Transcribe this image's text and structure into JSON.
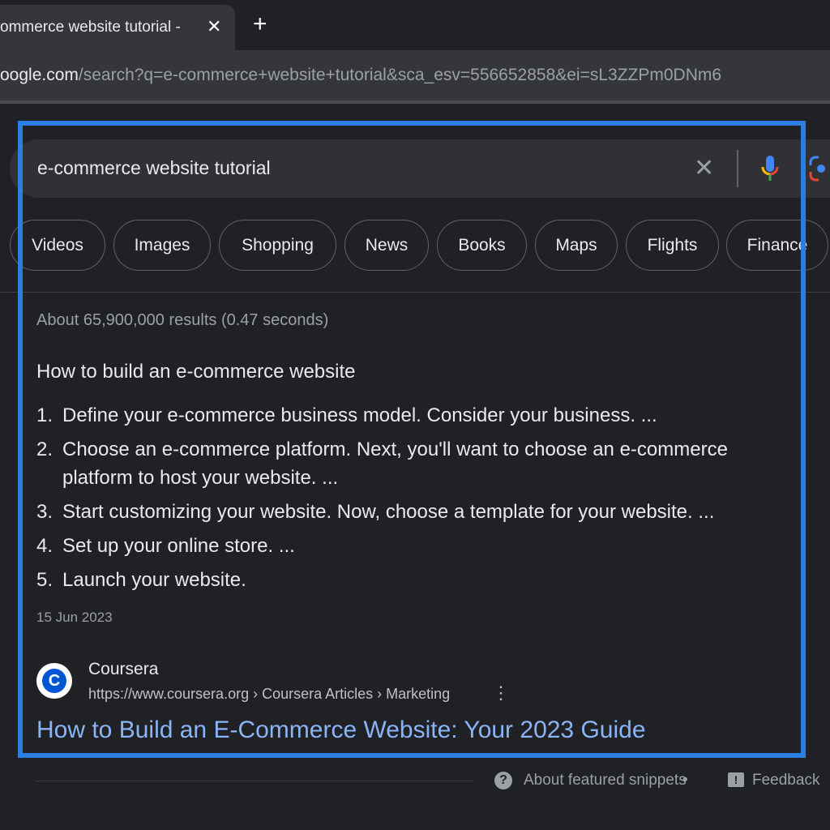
{
  "browser": {
    "tab_title": "e-commerce website tutorial - Google Search",
    "tab_title_visible": "ommerce website tutorial -",
    "url_host": "oogle.com",
    "url_path": "/search?q=e-commerce+website+tutorial&sca_esv=556652858&ei=sL3ZZPm0DNm6"
  },
  "search": {
    "query": "e-commerce website tutorial",
    "chips": [
      "Videos",
      "Images",
      "Shopping",
      "News",
      "Books",
      "Maps",
      "Flights",
      "Finance"
    ]
  },
  "results": {
    "stats": "About 65,900,000 results (0.47 seconds)",
    "snippet": {
      "heading": "How to build an e-commerce website",
      "items": [
        {
          "n": "1.",
          "text": "Define your e-commerce business model. Consider your business. ..."
        },
        {
          "n": "2.",
          "text": "Choose an e-commerce platform. Next, you'll want to choose an e-commerce platform to host your website. ..."
        },
        {
          "n": "3.",
          "text": "Start customizing your website. Now, choose a template for your website. ..."
        },
        {
          "n": "4.",
          "text": "Set up your online store. ..."
        },
        {
          "n": "5.",
          "text": "Launch your website."
        }
      ],
      "date": "15 Jun 2023",
      "site_name": "Coursera",
      "favicon_letter": "C",
      "cite": "https://www.coursera.org › Coursera Articles › Marketing",
      "title": "How to Build an E-Commerce Website: Your 2023 Guide"
    },
    "footer": {
      "about": "About featured snippets",
      "separator": "•",
      "feedback": "Feedback"
    }
  },
  "colors": {
    "background": "#202124",
    "link": "#8ab4f8",
    "highlight": "#2a7de1"
  }
}
